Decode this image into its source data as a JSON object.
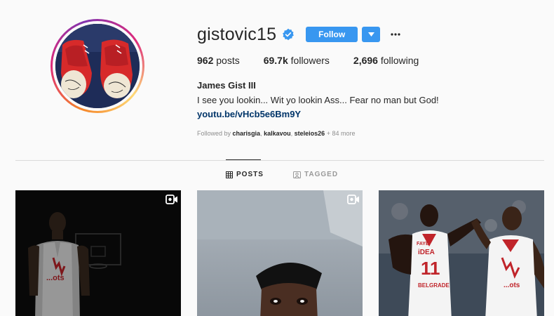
{
  "profile": {
    "username": "gistovic15",
    "verified": true,
    "follow_label": "Follow",
    "stats": {
      "posts_count": "962",
      "posts_label": "posts",
      "followers_count": "69.7k",
      "followers_label": "followers",
      "following_count": "2,696",
      "following_label": "following"
    },
    "full_name": "James Gist III",
    "bio": "I see you lookin... Wit yo lookin Ass... Fear no man but God!",
    "link": "youtu.be/vHcb5e6Bm9Y",
    "followed_by": {
      "prefix": "Followed by",
      "users": [
        "charisgia",
        "kalkavou",
        "steleios26"
      ],
      "more": "+ 84 more"
    }
  },
  "tabs": {
    "posts": "POSTS",
    "tagged": "TAGGED"
  },
  "posts": [
    {
      "type": "video",
      "icon": "video-icon",
      "jersey_text": "...ots"
    },
    {
      "type": "video",
      "icon": "video-icon"
    },
    {
      "type": "photo",
      "jersey_name": "FAYE",
      "jersey_sponsor": "iDEA",
      "jersey_number": "11",
      "jersey_city": "BELGRADE",
      "jersey_text_right": "...ots"
    }
  ],
  "colors": {
    "accent": "#3897f0",
    "link": "#003569",
    "verified": "#3897f0",
    "muted": "#8e8e8e"
  }
}
